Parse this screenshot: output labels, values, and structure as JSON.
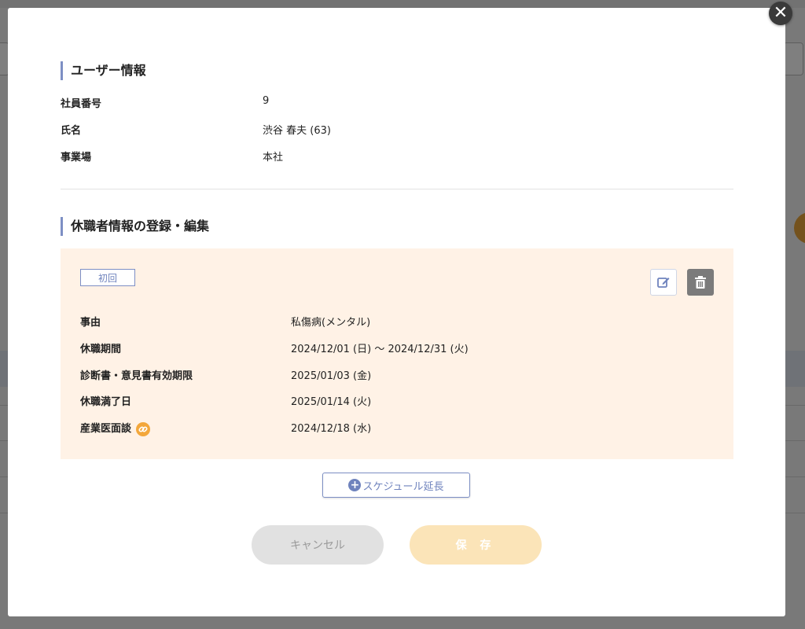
{
  "user_info": {
    "title": "ユーザー情報",
    "fields": [
      {
        "label": "社員番号",
        "value": "9"
      },
      {
        "label": "氏名",
        "value": "渋谷 春夫 (63)"
      },
      {
        "label": "事業場",
        "value": "本社"
      }
    ]
  },
  "leave_section": {
    "title": "休職者情報の登録・編集",
    "card": {
      "tag": "初回",
      "fields": [
        {
          "label": "事由",
          "value": "私傷病(メンタル)"
        },
        {
          "label": "休職期間",
          "value": "2024/12/01 (日) 〜 2024/12/31 (火)"
        },
        {
          "label": "診断書・意見書有効期限",
          "value": "2025/01/03 (金)"
        },
        {
          "label": "休職満了日",
          "value": "2025/01/14 (火)"
        },
        {
          "label": "産業医面談",
          "value": "2024/12/18 (水)"
        }
      ]
    },
    "extend_button": "スケジュール延長"
  },
  "footer": {
    "cancel_label": "キャンセル",
    "save_label": "保 存"
  },
  "icons": {
    "close": "close-icon",
    "edit": "edit-icon",
    "delete": "trash-icon",
    "link": "link-icon",
    "plus": "plus-circle-icon"
  },
  "colors": {
    "accent": "#7d8fc4",
    "card_bg": "#fff2e6",
    "link_icon": "#f3a73b",
    "save_button": "#fbe4b8",
    "cancel_button": "#e1e1e1"
  }
}
